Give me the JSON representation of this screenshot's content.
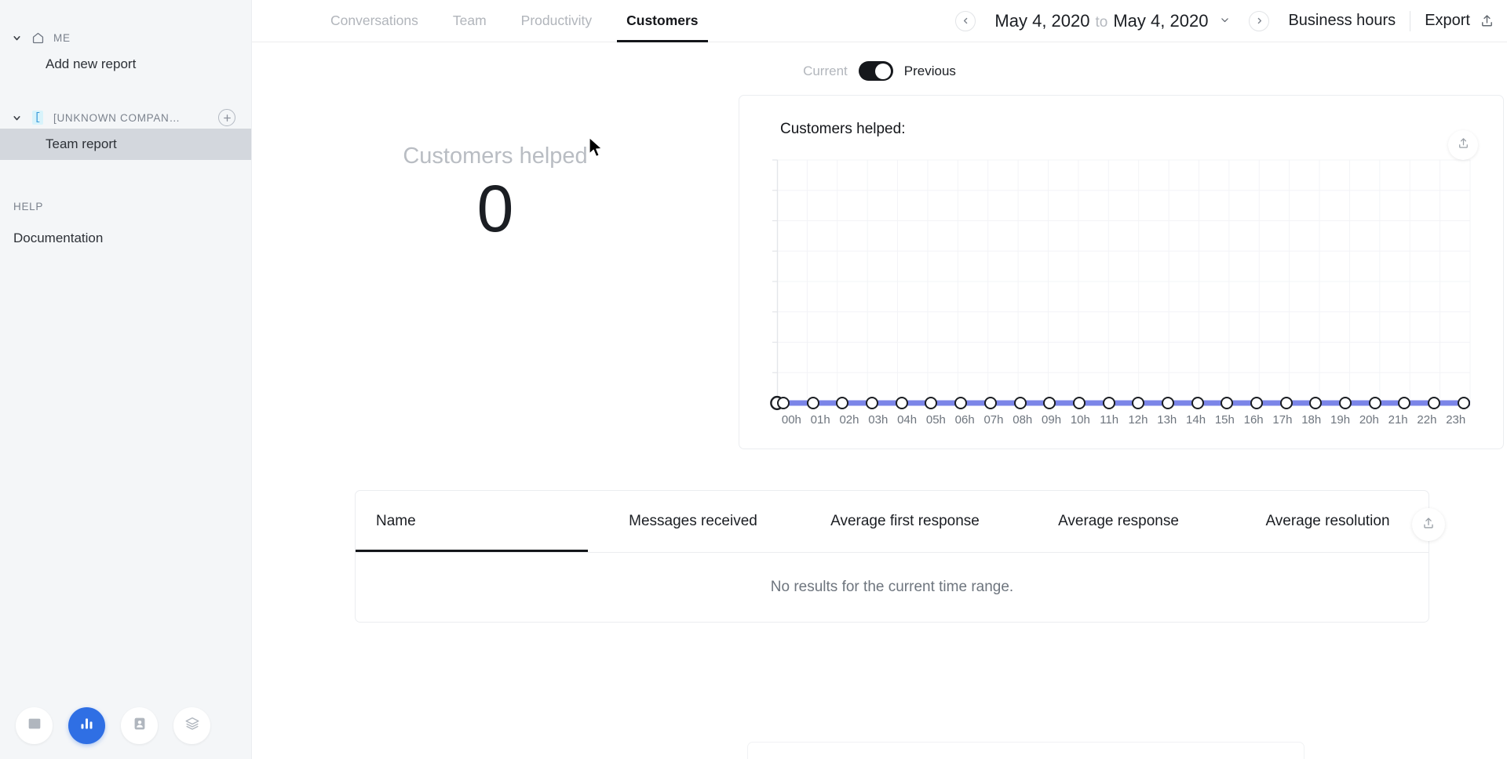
{
  "sidebar": {
    "me_section": {
      "label": "ME",
      "icon": "home-icon",
      "items": [
        {
          "label": "Add new report"
        }
      ]
    },
    "company_section": {
      "label": "[UNKNOWN COMPAN…",
      "bracket_glyph": "[",
      "add_label": "+",
      "items": [
        {
          "label": "Team report",
          "selected": true
        }
      ]
    },
    "help_section": {
      "label": "HELP",
      "items": [
        {
          "label": "Documentation"
        }
      ]
    },
    "app_switcher": [
      {
        "icon": "inbox-icon",
        "active": false
      },
      {
        "icon": "bar-chart-icon",
        "active": true
      },
      {
        "icon": "contact-card-icon",
        "active": false
      },
      {
        "icon": "layers-icon",
        "active": false
      }
    ]
  },
  "topbar": {
    "tabs": [
      {
        "label": "Conversations",
        "active": false
      },
      {
        "label": "Team",
        "active": false
      },
      {
        "label": "Productivity",
        "active": false
      },
      {
        "label": "Customers",
        "active": true
      }
    ],
    "prev_arrow": "‹",
    "next_arrow": "›",
    "date_start": "May 4, 2020",
    "date_joiner": "to",
    "date_end": "May 4, 2020",
    "date_chevron": "˅",
    "business_hours_label": "Business hours",
    "export_label": "Export",
    "export_icon": "upload-icon"
  },
  "comparison_toggle": {
    "left_label": "Current",
    "right_label": "Previous",
    "selected": "Previous"
  },
  "metric": {
    "label": "Customers helped",
    "value": "0"
  },
  "chart_card": {
    "title": "Customers helped:",
    "export_icon": "upload-icon"
  },
  "table": {
    "columns": [
      {
        "label": "Name",
        "sorted": true
      },
      {
        "label": "Messages received",
        "sorted": false
      },
      {
        "label": "Average first response",
        "sorted": false
      },
      {
        "label": "Average response",
        "sorted": false
      },
      {
        "label": "Average resolution",
        "sorted": false
      }
    ],
    "empty_message": "No results for the current time range.",
    "export_icon": "upload-icon"
  },
  "colors": {
    "accent_blue": "#2f6fe4",
    "series_line": "#7b85e8",
    "marker_stroke": "#1b1e23",
    "sidebar_bg": "#f4f6f8",
    "selected_row": "#d3d7dd"
  },
  "chart_data": {
    "type": "line",
    "title": "Customers helped:",
    "xlabel": "",
    "ylabel": "",
    "grid": true,
    "legend": false,
    "categories": [
      "00h",
      "01h",
      "02h",
      "03h",
      "04h",
      "05h",
      "06h",
      "07h",
      "08h",
      "09h",
      "10h",
      "11h",
      "12h",
      "13h",
      "14h",
      "15h",
      "16h",
      "17h",
      "18h",
      "19h",
      "20h",
      "21h",
      "22h",
      "23h"
    ],
    "series": [
      {
        "name": "Customers helped",
        "color": "#7b85e8",
        "values": [
          0,
          0,
          0,
          0,
          0,
          0,
          0,
          0,
          0,
          0,
          0,
          0,
          0,
          0,
          0,
          0,
          0,
          0,
          0,
          0,
          0,
          0,
          0,
          0
        ]
      }
    ],
    "ylim": [
      0,
      8
    ],
    "yticks": [
      0,
      1,
      2,
      3,
      4,
      5,
      6,
      7,
      8
    ]
  }
}
